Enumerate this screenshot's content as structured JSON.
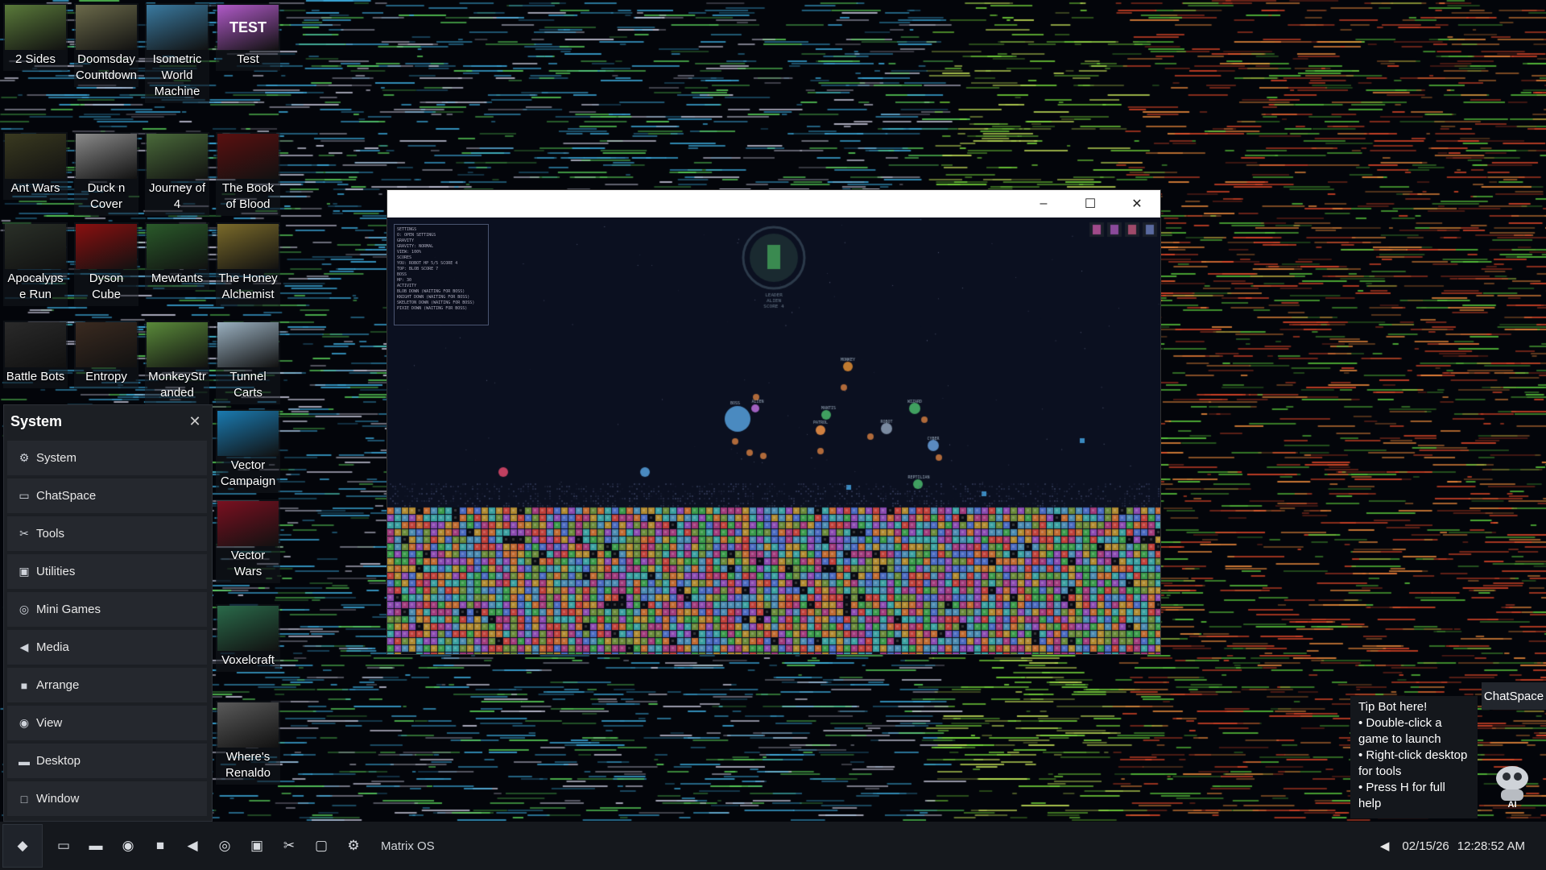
{
  "desktop": {
    "icons": [
      {
        "label": "2 Sides",
        "thumb": "#5a7a3a"
      },
      {
        "label": "Doomsday Countdown",
        "thumb": "#6b6a4a"
      },
      {
        "label": "Isometric World Machine",
        "thumb": "#3a7aa0"
      },
      {
        "label": "Test",
        "thumb": "#b05ac8"
      },
      {
        "label": "Ant Wars",
        "thumb": "#3a3a20"
      },
      {
        "label": "Duck n Cover",
        "thumb": "#8a8a8a"
      },
      {
        "label": "Journey of 4",
        "thumb": "#4a6a3a"
      },
      {
        "label": "The Book of Blood",
        "thumb": "#5a1010"
      },
      {
        "label": "Apocalypse Run",
        "thumb": "#2a3028"
      },
      {
        "label": "Dyson Cube",
        "thumb": "#8a1010"
      },
      {
        "label": "Mewtants",
        "thumb": "#2a5a2a"
      },
      {
        "label": "The Honey Alchemist",
        "thumb": "#7a6a2a"
      },
      {
        "label": "Battle Bots",
        "thumb": "#2a2a2a"
      },
      {
        "label": "Entropy",
        "thumb": "#3a2a20"
      },
      {
        "label": "MonkeyStranded",
        "thumb": "#5a8a3a"
      },
      {
        "label": "Tunnel Carts",
        "thumb": "#9ab0c0"
      },
      {
        "label": "Vector Campaign",
        "thumb": "#1a7ab0"
      },
      {
        "label": "Vector Wars",
        "thumb": "#7a1020"
      },
      {
        "label": "Voxelcraft",
        "thumb": "#2a6a4a"
      },
      {
        "label": "Where's Renaldo",
        "thumb": "#5a5a5a"
      }
    ],
    "test_thumb_text": "TEST"
  },
  "system_panel": {
    "title": "System",
    "close": "✕",
    "items": [
      {
        "label": "System",
        "icon": "gear-icon",
        "glyph": "⚙"
      },
      {
        "label": "ChatSpace",
        "icon": "chat-icon",
        "glyph": "▭"
      },
      {
        "label": "Tools",
        "icon": "tools-icon",
        "glyph": "✂"
      },
      {
        "label": "Utilities",
        "icon": "toolbox-icon",
        "glyph": "▣"
      },
      {
        "label": "Mini Games",
        "icon": "gamepad-icon",
        "glyph": "◎"
      },
      {
        "label": "Media",
        "icon": "speaker-icon",
        "glyph": "◀"
      },
      {
        "label": "Arrange",
        "icon": "square-icon",
        "glyph": "■"
      },
      {
        "label": "View",
        "icon": "eye-icon",
        "glyph": "◉"
      },
      {
        "label": "Desktop",
        "icon": "monitor-icon",
        "glyph": "▬"
      },
      {
        "label": "Window",
        "icon": "window-icon",
        "glyph": "□"
      }
    ]
  },
  "game_window": {
    "minimize": "–",
    "maximize": "☐",
    "close": "✕",
    "hud_lines": [
      "SETTINGS",
      "O: OPEN SETTINGS",
      "GRAVITY",
      "GRAVITY: NORMAL",
      "VIEW: 100%",
      "SCORES",
      "YOU: ROBOT  HP 5/5  SCORE 4",
      "TOP: BLOB  SCORE 7",
      "BOSS",
      "HP: 30",
      "ACTIVITY",
      "BLOB DOWN (WAITING FOR BOSS)",
      "KNIGHT DOWN (WAITING FOR BOSS)",
      "SKELETON DOWN (WAITING FOR BOSS)",
      "PIXIE DOWN (WAITING FOR BOSS)"
    ],
    "leader_text": "LEADER",
    "leader_name": "ALIEN",
    "leader_score": "SCORE 4",
    "player_tags": [
      "BOSS",
      "MONKEY",
      "MANTIS",
      "ALIEN",
      "ROBOT",
      "CYBER",
      "REPTILIAN",
      "PATROL",
      "WIZARD"
    ]
  },
  "tip_bot": {
    "lines": [
      "Tip Bot here!",
      "• Double-click a game to launch",
      "• Right-click desktop for tools",
      "• Press H for full help"
    ],
    "chat_button": "ChatSpace",
    "bot_label": "AI"
  },
  "taskbar": {
    "os_label": "Matrix OS",
    "date": "02/15/26",
    "time": "12:28:52 AM",
    "start_glyph": "◆",
    "icons": [
      {
        "name": "window-icon",
        "glyph": "▭"
      },
      {
        "name": "desktop-icon",
        "glyph": "▬"
      },
      {
        "name": "eye-icon",
        "glyph": "◉"
      },
      {
        "name": "arrange-icon",
        "glyph": "■"
      },
      {
        "name": "speaker-icon",
        "glyph": "◀"
      },
      {
        "name": "gamepad-icon",
        "glyph": "◎"
      },
      {
        "name": "toolbox-icon",
        "glyph": "▣"
      },
      {
        "name": "tools-icon",
        "glyph": "✂"
      },
      {
        "name": "chat-icon",
        "glyph": "▢"
      },
      {
        "name": "gear-icon",
        "glyph": "⚙"
      }
    ],
    "volume_glyph": "◀"
  }
}
